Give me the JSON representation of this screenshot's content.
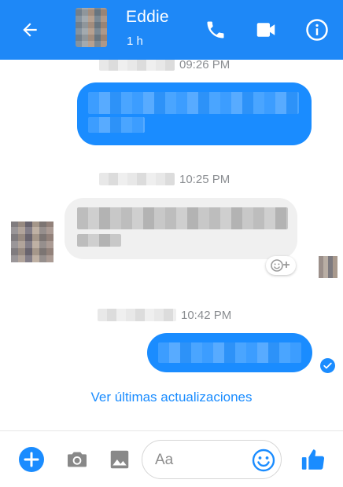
{
  "header": {
    "title": "Eddie",
    "subtitle": "1 h",
    "icons": {
      "back": "arrow-left-icon",
      "call": "phone-icon",
      "video": "video-camera-icon",
      "info": "info-icon"
    },
    "color": "#1e88f7"
  },
  "chat": {
    "timestamps": [
      "09:26 PM",
      "10:25 PM",
      "10:42 PM"
    ],
    "updates_link": "Ver últimas actualizaciones",
    "colors": {
      "outgoing_bubble": "#1a8cff",
      "incoming_bubble": "#f0f0f0",
      "link": "#1a8cff"
    }
  },
  "composer": {
    "placeholder": "Aa",
    "icons": {
      "add": "plus-circle-icon",
      "camera": "camera-icon",
      "gallery": "image-icon",
      "emoji": "smiley-icon",
      "like": "thumbs-up-icon"
    }
  }
}
